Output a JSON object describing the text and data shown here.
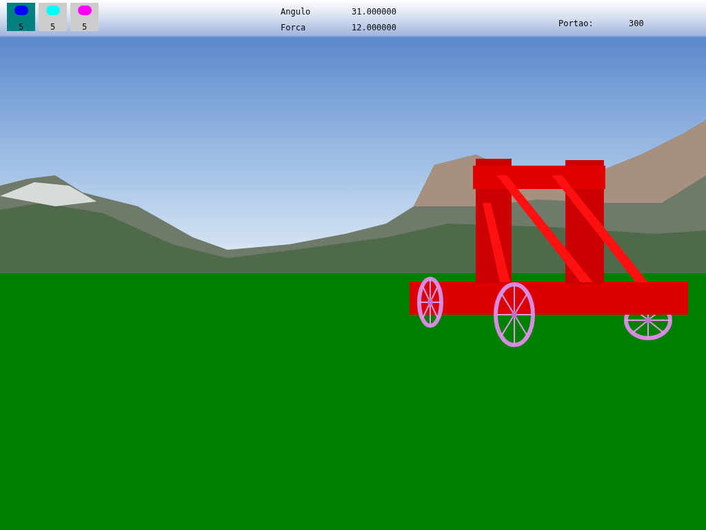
{
  "ammo": [
    {
      "selected": true,
      "color": "#0000ff",
      "count": "5"
    },
    {
      "selected": false,
      "color": "#00ffff",
      "count": "5"
    },
    {
      "selected": false,
      "color": "#ff00ff",
      "count": "5"
    }
  ],
  "stats": [
    {
      "label": "Angulo",
      "value": "31.000000"
    },
    {
      "label": "Forca",
      "value": "12.000000"
    }
  ],
  "gate": {
    "label": "Portao:",
    "value": "300"
  }
}
